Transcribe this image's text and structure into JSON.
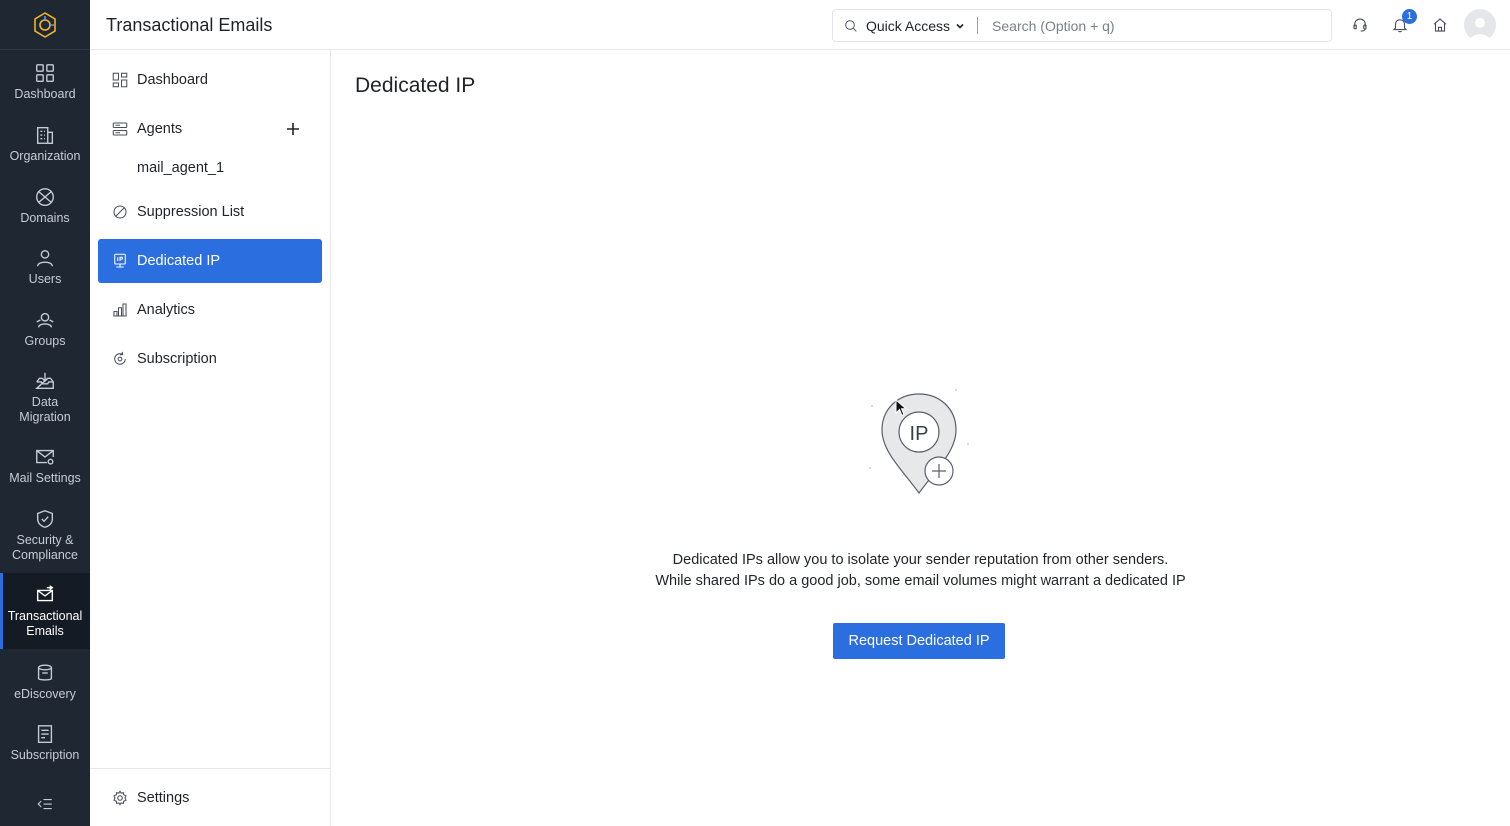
{
  "rail": {
    "items": [
      {
        "label": "Dashboard",
        "icon": "grid-icon"
      },
      {
        "label": "Organization",
        "icon": "building-icon"
      },
      {
        "label": "Domains",
        "icon": "globe-icon"
      },
      {
        "label": "Users",
        "icon": "user-icon"
      },
      {
        "label": "Groups",
        "icon": "group-icon"
      },
      {
        "label": "Data\nMigration",
        "line1": "Data",
        "line2": "Migration",
        "icon": "inbox-download-icon"
      },
      {
        "label": "Mail Settings",
        "icon": "mail-gear-icon"
      },
      {
        "label": "Security & Compliance",
        "line1": "Security &",
        "line2": "Compliance",
        "icon": "shield-check-icon"
      },
      {
        "label": "Transactional Emails",
        "line1": "Transactional",
        "line2": "Emails",
        "icon": "mail-send-icon"
      },
      {
        "label": "eDiscovery",
        "icon": "archive-icon"
      },
      {
        "label": "Subscription",
        "icon": "receipt-icon"
      }
    ],
    "active_index": 8
  },
  "header": {
    "title": "Transactional Emails",
    "quick_access": "Quick Access",
    "search_placeholder": "Search (Option + q)",
    "notification_count": "1"
  },
  "subnav": {
    "dashboard": "Dashboard",
    "agents": "Agents",
    "agent_1": "mail_agent_1",
    "suppression": "Suppression List",
    "dedicated_ip": "Dedicated IP",
    "analytics": "Analytics",
    "subscription": "Subscription",
    "settings": "Settings"
  },
  "main": {
    "title": "Dedicated IP",
    "illustration_text": "IP",
    "desc_line1": "Dedicated IPs allow you to isolate your sender reputation from other senders.",
    "desc_line2": "While shared IPs do a good job, some email volumes might warrant a dedicated IP",
    "cta": "Request Dedicated IP"
  },
  "colors": {
    "rail_bg": "#1f2733",
    "accent": "#2b6ee0"
  }
}
